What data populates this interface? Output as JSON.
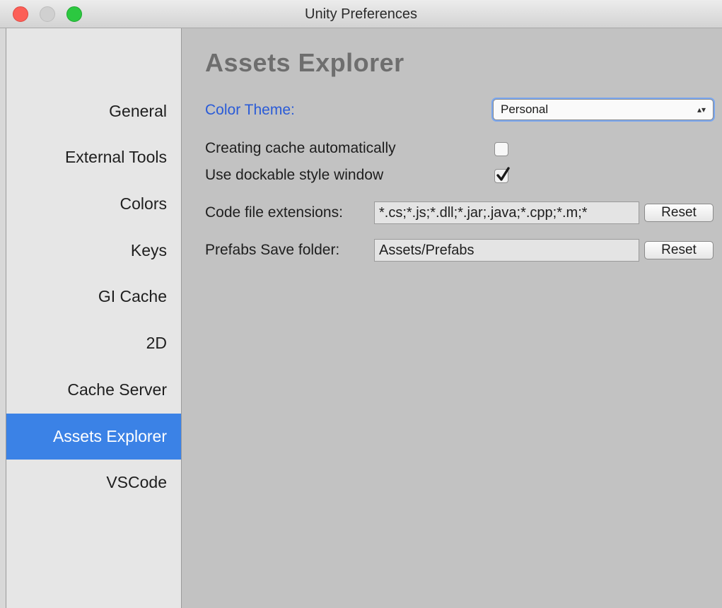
{
  "window": {
    "title": "Unity Preferences"
  },
  "sidebar": {
    "items": [
      {
        "label": "General"
      },
      {
        "label": "External Tools"
      },
      {
        "label": "Colors"
      },
      {
        "label": "Keys"
      },
      {
        "label": "GI Cache"
      },
      {
        "label": "2D"
      },
      {
        "label": "Cache Server"
      },
      {
        "label": "Assets Explorer",
        "selected": true
      },
      {
        "label": "VSCode"
      }
    ],
    "selected_color": "#3b82e6"
  },
  "main": {
    "title": "Assets Explorer",
    "color_theme": {
      "label": "Color Theme:",
      "value": "Personal",
      "arrow_icon": "updown-arrow-icon"
    },
    "creating_cache": {
      "label": "Creating cache automatically",
      "checked": false
    },
    "dockable": {
      "label": "Use dockable style window",
      "checked": true
    },
    "code_ext": {
      "label": "Code file extensions:",
      "value": "*.cs;*.js;*.dll;*.jar;.java;*.cpp;*.m;*",
      "reset_label": "Reset"
    },
    "prefabs": {
      "label": "Prefabs Save folder:",
      "value": "Assets/Prefabs",
      "reset_label": "Reset"
    },
    "accent_color": "#2a5bd7"
  }
}
